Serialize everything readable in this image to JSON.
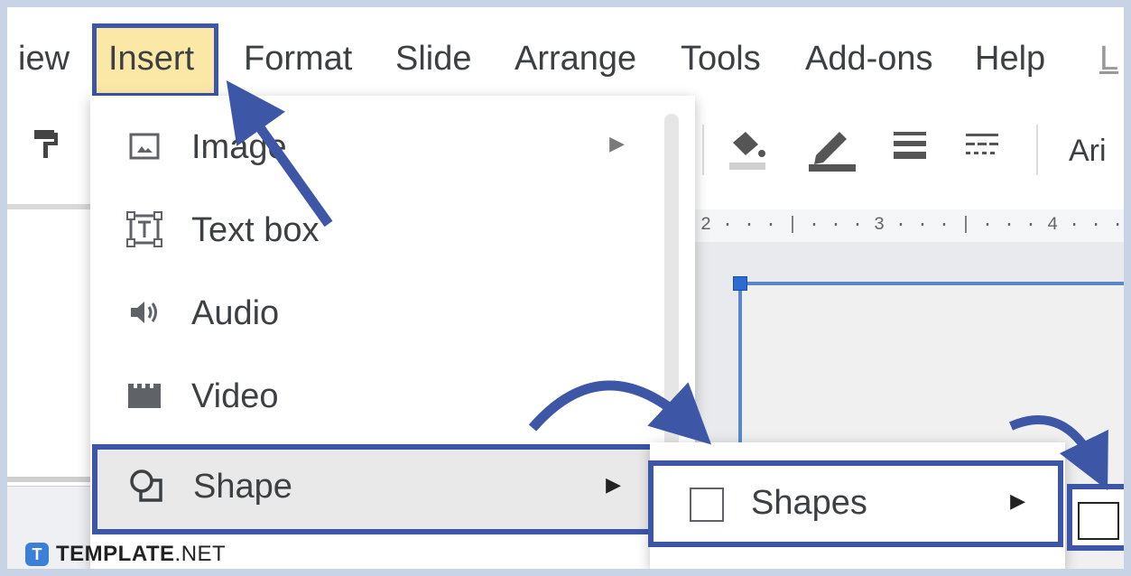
{
  "menubar": {
    "items": [
      {
        "label": "iew"
      },
      {
        "label": "Insert"
      },
      {
        "label": "Format"
      },
      {
        "label": "Slide"
      },
      {
        "label": "Arrange"
      },
      {
        "label": "Tools"
      },
      {
        "label": "Add-ons"
      },
      {
        "label": "Help"
      },
      {
        "label": "L"
      }
    ]
  },
  "toolbar": {
    "font_partial": "Ari"
  },
  "ruler": {
    "text": "2 · · · | · · · 3 · · · | · · · 4 · · ·"
  },
  "insert_menu": {
    "items": [
      {
        "label": "Image",
        "icon": "image-icon",
        "has_submenu": true
      },
      {
        "label": "Text box",
        "icon": "text-box-icon",
        "has_submenu": false
      },
      {
        "label": "Audio",
        "icon": "audio-icon",
        "has_submenu": false
      },
      {
        "label": "Video",
        "icon": "video-icon",
        "has_submenu": false
      },
      {
        "label": "Shape",
        "icon": "shape-icon",
        "has_submenu": true
      }
    ]
  },
  "shape_submenu": {
    "items": [
      {
        "label": "Shapes",
        "icon": "square-icon",
        "has_submenu": true
      }
    ]
  },
  "watermark": {
    "badge": "T",
    "brand": "TEMPLATE",
    "suffix": ".NET"
  },
  "colors": {
    "highlight_border": "#3d56a6",
    "insert_highlight": "#fbe7a6",
    "arrow": "#3d56a6",
    "brand": "#3a7fd8"
  }
}
